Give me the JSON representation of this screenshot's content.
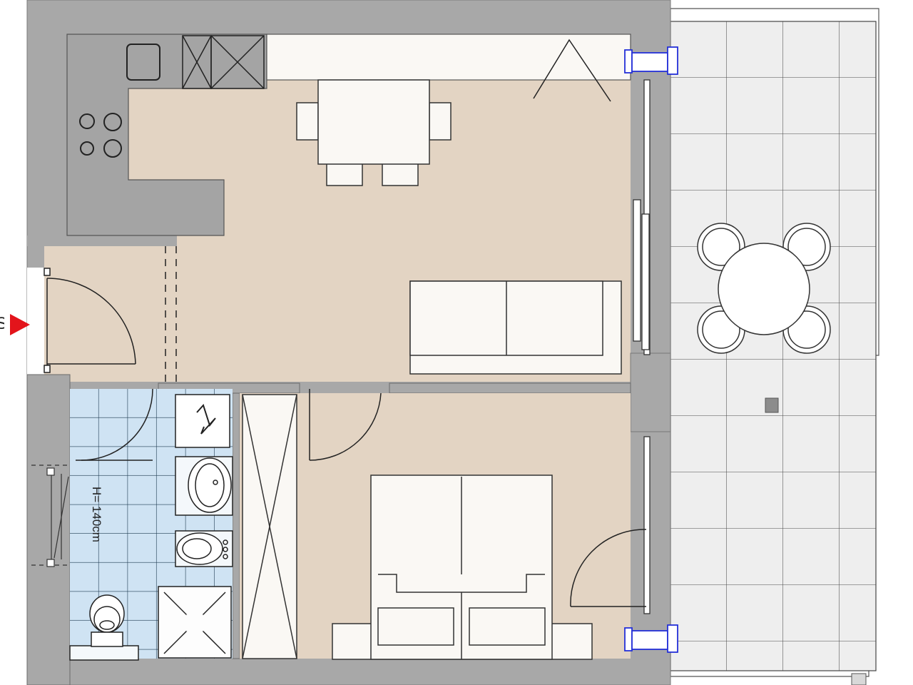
{
  "plan": {
    "height_label": "H= 140cm",
    "entrance_fragment": "S"
  },
  "colors": {
    "wall": "#a8a8a8",
    "wall_outline": "#7a7a7a",
    "wood_floor": "#e3d4c3",
    "bath_tile": "#cfe3f3",
    "terrace_tile": "#eeeeee",
    "kitchen_counter": "#a4a4a4",
    "furniture": "#faf8f4",
    "window_frame": "#2430d8",
    "entrance_arrow": "#e3141b"
  },
  "icons": {
    "entrance": "entrance-arrow-icon",
    "water_heater": "water-heater-icon"
  }
}
